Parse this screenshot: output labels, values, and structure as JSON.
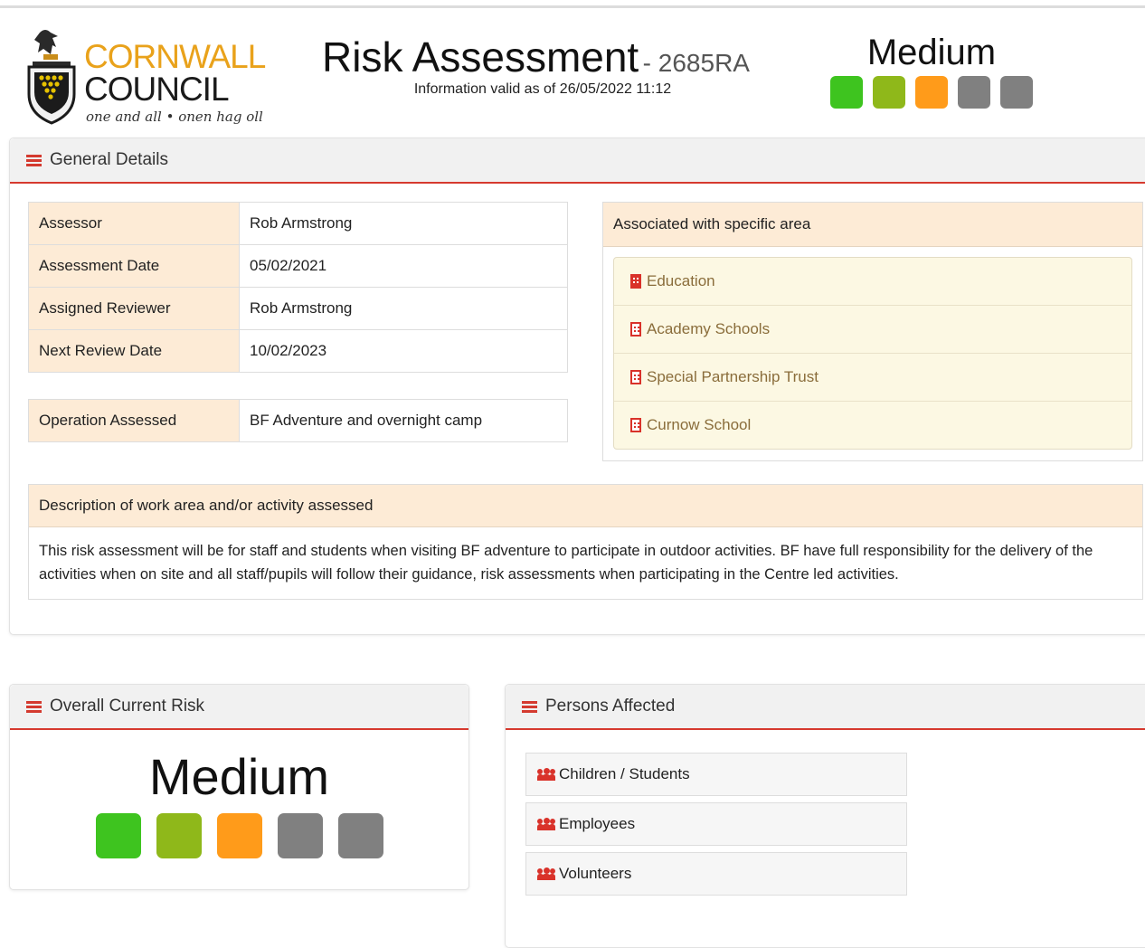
{
  "logo": {
    "line1": "CORNWALL",
    "line2": "COUNCIL",
    "motto": "one and all • onen hag oll"
  },
  "header": {
    "title": "Risk Assessment",
    "code": "- 2685RA",
    "valid_info": "Information valid as of 26/05/2022 11:12",
    "risk_level": "Medium",
    "risk_scale": [
      "#3ec41f",
      "#8fb81a",
      "#ff9b1a",
      "#808080",
      "#808080"
    ]
  },
  "general": {
    "heading": "General Details",
    "rows": [
      {
        "label": "Assessor",
        "value": "Rob Armstrong"
      },
      {
        "label": "Assessment Date",
        "value": "05/02/2021"
      },
      {
        "label": "Assigned Reviewer",
        "value": "Rob Armstrong"
      },
      {
        "label": "Next Review Date",
        "value": "10/02/2023"
      }
    ],
    "operation": {
      "label": "Operation Assessed",
      "value": "BF Adventure and overnight camp"
    },
    "area_heading": "Associated with specific area",
    "areas": [
      "Education",
      "Academy Schools",
      "Special Partnership Trust",
      "Curnow School"
    ],
    "description_heading": "Description of work area and/or activity assessed",
    "description": "This risk assessment will be for staff and students when visiting BF adventure to participate in outdoor activities. BF have full responsibility for the delivery of the activities when on site and all staff/pupils will follow their guidance, risk assessments when participating in the Centre led activities."
  },
  "overall": {
    "heading": "Overall Current Risk",
    "level": "Medium"
  },
  "persons": {
    "heading": "Persons Affected",
    "items": [
      "Children / Students",
      "Employees",
      "Volunteers"
    ]
  },
  "icons": {
    "menu": "menu-icon",
    "building": "building-icon",
    "users": "users-icon",
    "crest": "council-crest-icon"
  }
}
